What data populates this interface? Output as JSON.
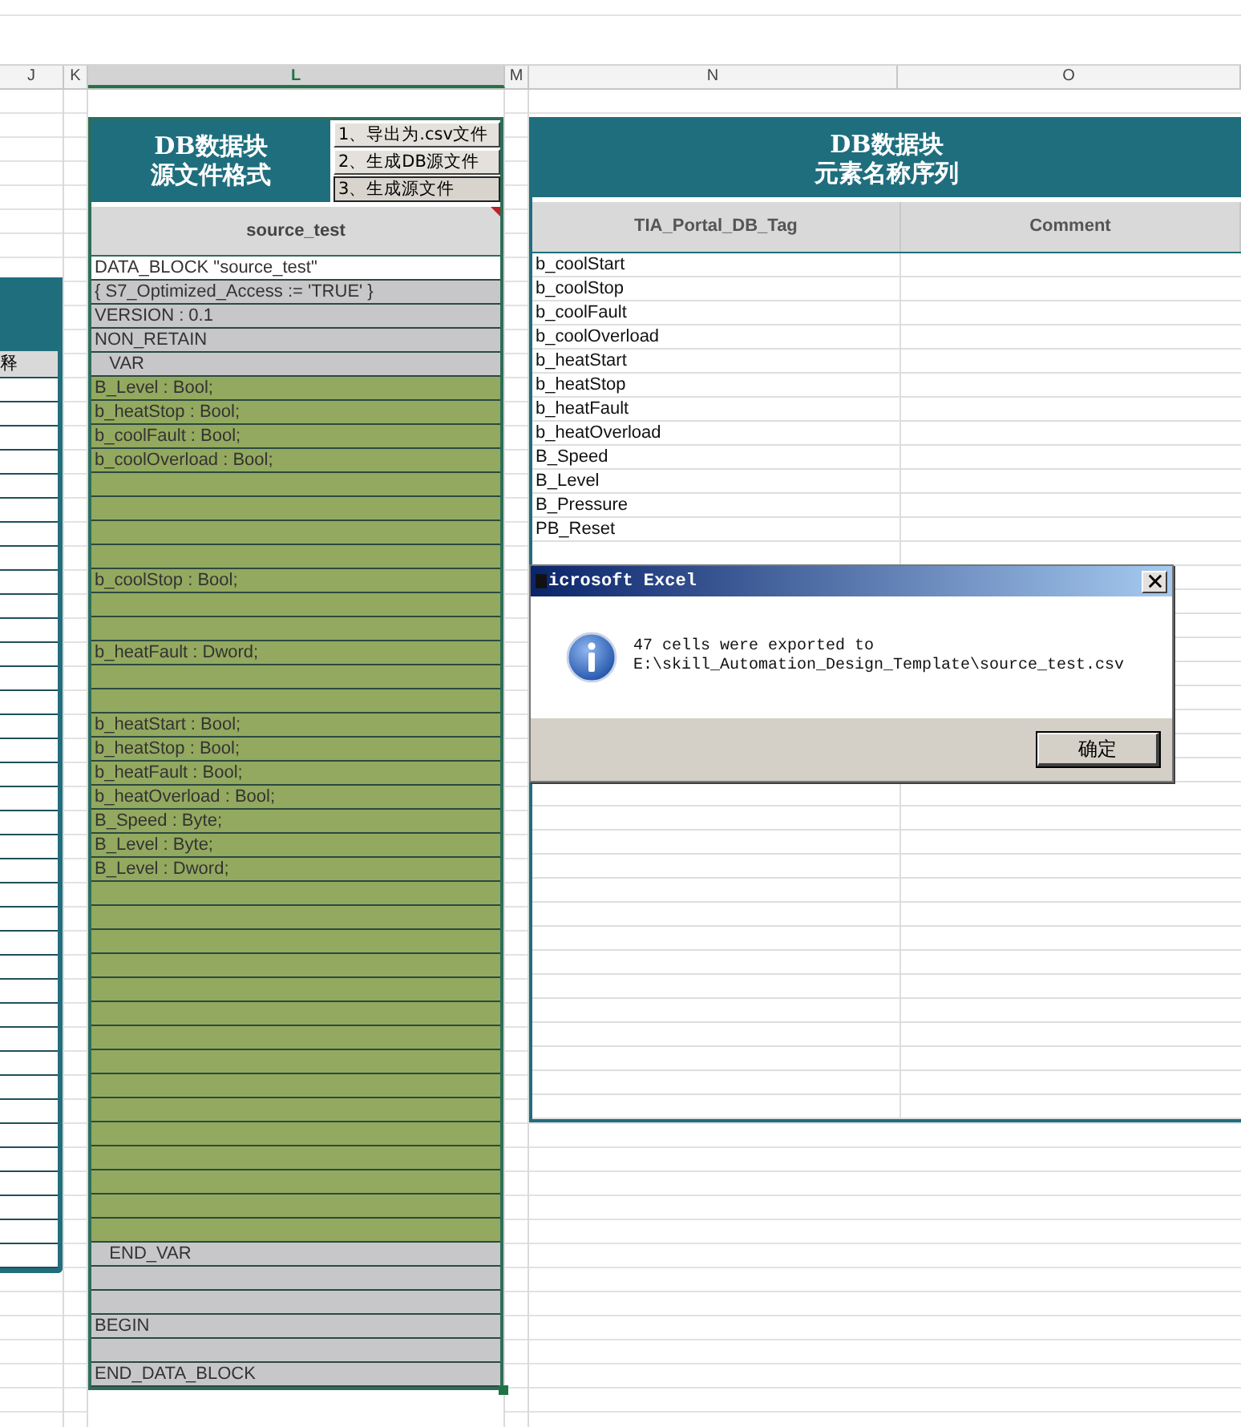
{
  "column_headers": [
    {
      "label": "J",
      "selected": false
    },
    {
      "label": "K",
      "selected": false
    },
    {
      "label": "L",
      "selected": true
    },
    {
      "label": "M",
      "selected": false
    },
    {
      "label": "N",
      "selected": false
    },
    {
      "label": "O",
      "selected": false
    }
  ],
  "left_table": {
    "header_cell": "释"
  },
  "source_panel": {
    "title_lines": [
      "DB数据块",
      "源文件格式"
    ],
    "buttons": [
      {
        "label": "1、导出为.csv文件",
        "pressed": false
      },
      {
        "label": "2、生成DB源文件",
        "pressed": false
      },
      {
        "label": "3、生成源文件",
        "pressed": true
      }
    ],
    "column_title": "source_test",
    "rows": [
      {
        "kind": "plain",
        "text": "DATA_BLOCK \"source_test\""
      },
      {
        "kind": "meta",
        "text": "{ S7_Optimized_Access := 'TRUE' }"
      },
      {
        "kind": "meta",
        "text": "VERSION : 0.1"
      },
      {
        "kind": "meta",
        "text": "NON_RETAIN"
      },
      {
        "kind": "meta",
        "text": "   VAR"
      },
      {
        "kind": "var",
        "text": "B_Level : Bool;"
      },
      {
        "kind": "var",
        "text": "b_heatStop : Bool;"
      },
      {
        "kind": "var",
        "text": "b_coolFault : Bool;"
      },
      {
        "kind": "var",
        "text": "b_coolOverload : Bool;"
      },
      {
        "kind": "var"
      },
      {
        "kind": "var"
      },
      {
        "kind": "var"
      },
      {
        "kind": "var"
      },
      {
        "kind": "var",
        "text": "b_coolStop : Bool;"
      },
      {
        "kind": "var"
      },
      {
        "kind": "var"
      },
      {
        "kind": "var",
        "text": "b_heatFault : Dword;"
      },
      {
        "kind": "var"
      },
      {
        "kind": "var"
      },
      {
        "kind": "var",
        "text": "b_heatStart : Bool;"
      },
      {
        "kind": "var",
        "text": "b_heatStop : Bool;"
      },
      {
        "kind": "var",
        "text": "b_heatFault : Bool;"
      },
      {
        "kind": "var",
        "text": "b_heatOverload : Bool;"
      },
      {
        "kind": "var",
        "text": "B_Speed : Byte;"
      },
      {
        "kind": "var",
        "text": "B_Level : Byte;"
      },
      {
        "kind": "var",
        "text": "B_Level : Dword;"
      },
      {
        "kind": "var"
      },
      {
        "kind": "var"
      },
      {
        "kind": "var"
      },
      {
        "kind": "var"
      },
      {
        "kind": "var"
      },
      {
        "kind": "var"
      },
      {
        "kind": "var"
      },
      {
        "kind": "var"
      },
      {
        "kind": "var"
      },
      {
        "kind": "var"
      },
      {
        "kind": "var"
      },
      {
        "kind": "var"
      },
      {
        "kind": "var"
      },
      {
        "kind": "var"
      },
      {
        "kind": "var"
      },
      {
        "kind": "meta",
        "text": "   END_VAR"
      },
      {
        "kind": "meta"
      },
      {
        "kind": "meta"
      },
      {
        "kind": "meta",
        "text": "BEGIN"
      },
      {
        "kind": "meta"
      },
      {
        "kind": "meta",
        "text": "END_DATA_BLOCK"
      }
    ]
  },
  "tag_panel": {
    "title_lines": [
      "DB数据块",
      "元素名称序列"
    ],
    "columns": [
      "TIA_Portal_DB_Tag",
      "Comment"
    ],
    "rows": [
      "b_coolStart",
      "b_coolStop",
      "b_coolFault",
      "b_coolOverload",
      "b_heatStart",
      "b_heatStop",
      "b_heatFault",
      "b_heatOverload",
      "B_Speed",
      "B_Level",
      "B_Pressure",
      "PB_Reset"
    ]
  },
  "dialog": {
    "title": "icrosoft Excel",
    "message_lines": [
      "47 cells were exported to",
      "E:\\skill_Automation_Design_Template\\source_test.csv"
    ],
    "button": "确定"
  }
}
